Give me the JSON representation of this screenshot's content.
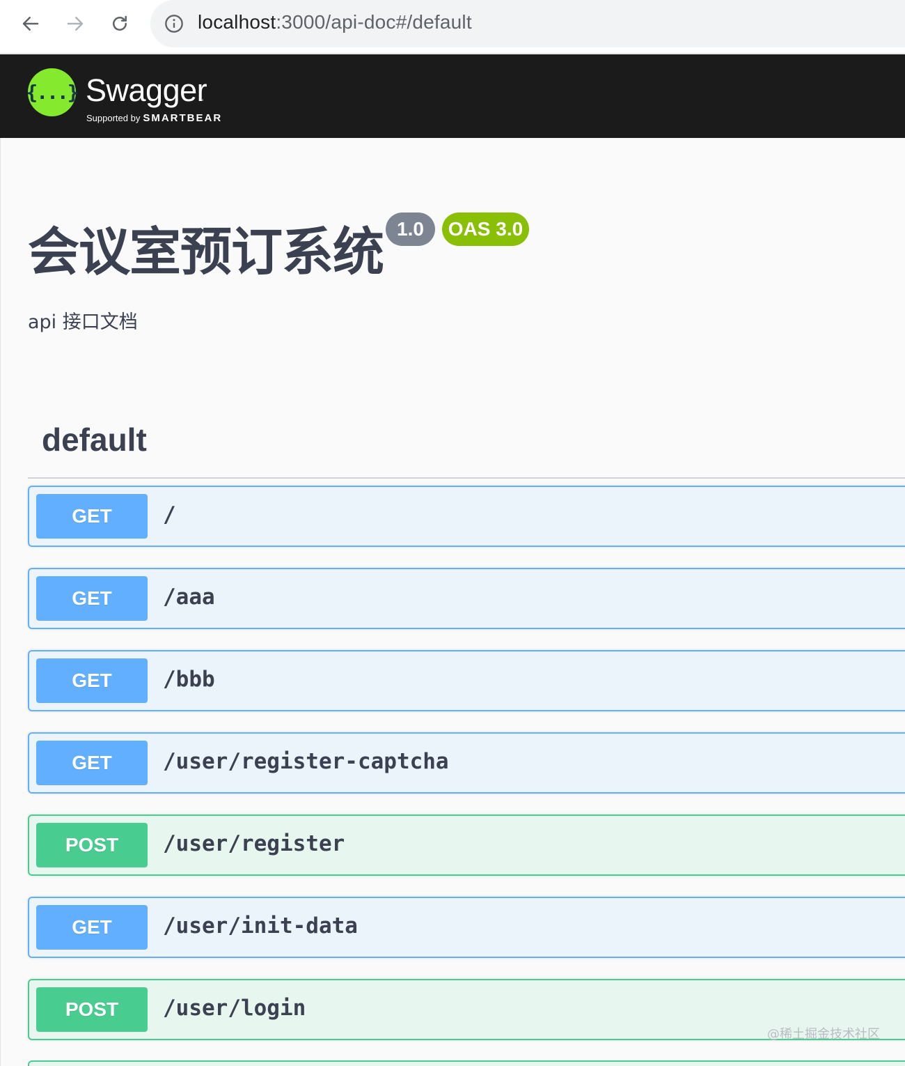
{
  "browser": {
    "url_host": "localhost",
    "url_rest": ":3000/api-doc#/default"
  },
  "topbar": {
    "logo_mark": "{...}",
    "logo_name": "Swagger",
    "logo_tm": "™",
    "supported_by": "Supported by",
    "company": "SMARTBEAR",
    "background_color": "#1b1b1b",
    "logo_color": "#85ea2d"
  },
  "info": {
    "title": "会议室预订系统",
    "version": "1.0",
    "oas": "OAS 3.0",
    "description": "api 接口文档"
  },
  "tag": {
    "name": "default"
  },
  "operations": [
    {
      "method": "GET",
      "path": "/"
    },
    {
      "method": "GET",
      "path": "/aaa"
    },
    {
      "method": "GET",
      "path": "/bbb"
    },
    {
      "method": "GET",
      "path": "/user/register-captcha"
    },
    {
      "method": "POST",
      "path": "/user/register"
    },
    {
      "method": "GET",
      "path": "/user/init-data"
    },
    {
      "method": "POST",
      "path": "/user/login"
    }
  ],
  "colors": {
    "get": "#61affe",
    "post": "#49cc90",
    "version_badge": "#7d8492",
    "oas_badge": "#89bf04"
  },
  "watermark": "@稀土掘金技术社区"
}
